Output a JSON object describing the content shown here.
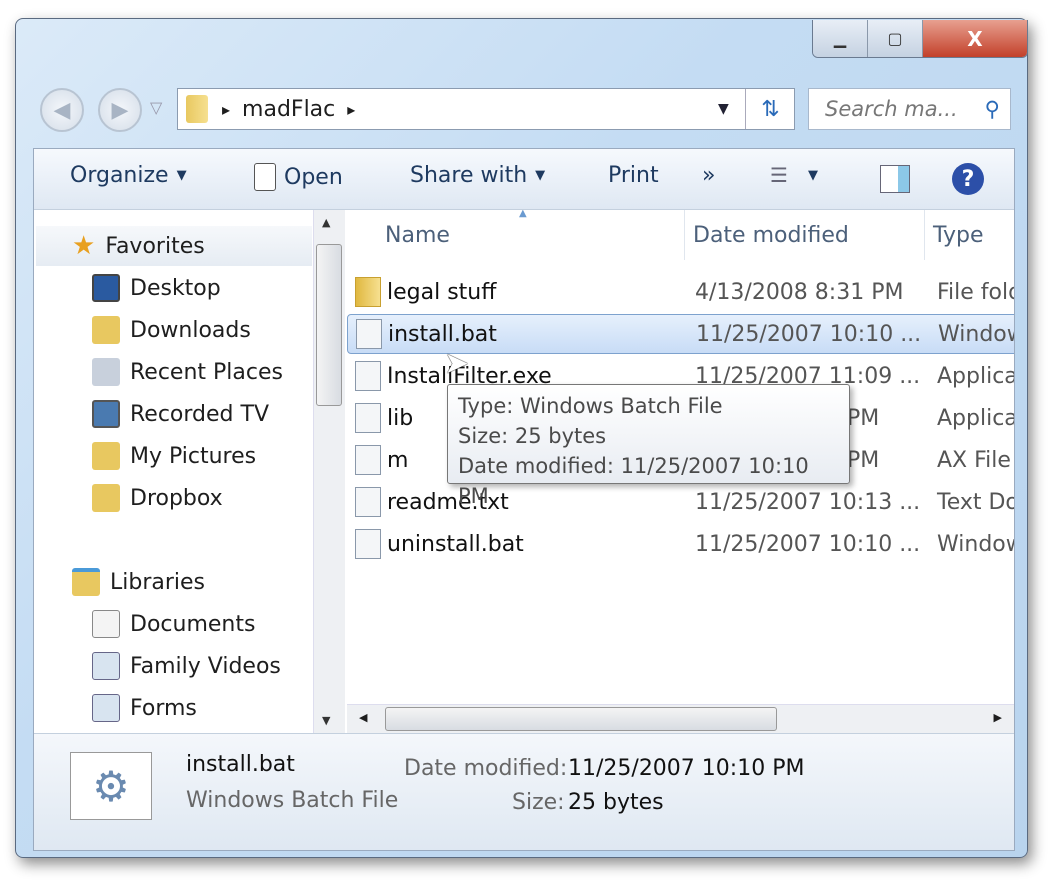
{
  "window": {
    "controls": {
      "minimize": "▁",
      "maximize": "▢",
      "close": "X"
    }
  },
  "nav": {
    "back": "◀",
    "forward": "▶",
    "history": "▽"
  },
  "address": {
    "crumbs": [
      "madFlac"
    ],
    "separator": "▸",
    "dropdown": "▼",
    "refresh": "⇅"
  },
  "search": {
    "placeholder": "Search ma..."
  },
  "toolbar": {
    "organize": "Organize",
    "open": "Open",
    "share": "Share with",
    "print": "Print",
    "more": "»",
    "dropdown": "▼"
  },
  "sidebar": {
    "favorites": {
      "label": "Favorites",
      "items": [
        "Desktop",
        "Downloads",
        "Recent Places",
        "Recorded TV",
        "My Pictures",
        "Dropbox"
      ]
    },
    "libraries": {
      "label": "Libraries",
      "items": [
        "Documents",
        "Family Videos",
        "Forms"
      ]
    }
  },
  "columns": [
    "Name",
    "Date modified",
    "Type"
  ],
  "files": [
    {
      "name": "legal stuff",
      "date": "4/13/2008 8:31 PM",
      "type": "File fold",
      "icon": "folder-icon"
    },
    {
      "name": "install.bat",
      "date": "11/25/2007 10:10 ...",
      "type": "Window",
      "icon": "batch-file-icon",
      "selected": true
    },
    {
      "name": "InstallFilter.exe",
      "date": "11/25/2007 11:09 ...",
      "type": "Applica",
      "icon": "exe-icon"
    },
    {
      "name": "lib",
      "date": "PM",
      "type": "Applica",
      "icon": "dll-icon"
    },
    {
      "name": "m",
      "date": "PM",
      "type": "AX File",
      "icon": "file-icon"
    },
    {
      "name": "readme.txt",
      "date": "11/25/2007 10:13 ...",
      "type": "Text Do",
      "icon": "text-file-icon"
    },
    {
      "name": "uninstall.bat",
      "date": "11/25/2007 10:10 ...",
      "type": "Window",
      "icon": "batch-file-icon"
    }
  ],
  "tooltip": {
    "type": "Type: Windows Batch File",
    "size": "Size: 25 bytes",
    "date": "Date modified: 11/25/2007 10:10 PM"
  },
  "details": {
    "name": "install.bat",
    "kind": "Windows Batch File",
    "date_label": "Date modified:",
    "date": "11/25/2007 10:10 PM",
    "size_label": "Size:",
    "size": "25 bytes"
  }
}
